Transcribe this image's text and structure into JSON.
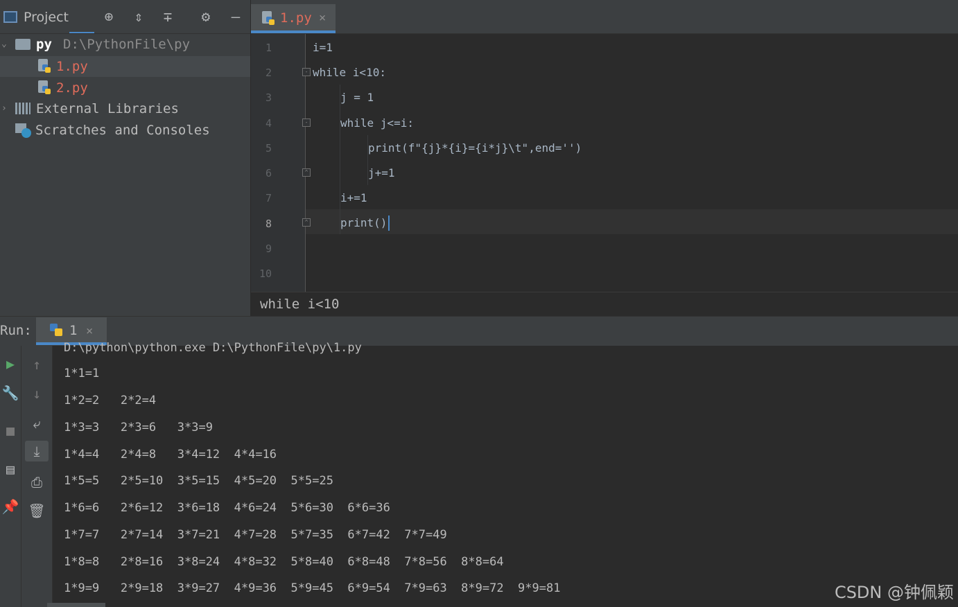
{
  "project": {
    "title": "Project",
    "tree": [
      {
        "name": "py",
        "path": "D:\\PythonFile\\py"
      },
      {
        "name": "1.py"
      },
      {
        "name": "2.py"
      },
      {
        "name": "External Libraries"
      },
      {
        "name": "Scratches and Consoles"
      }
    ]
  },
  "editor": {
    "tab_label": "1.py",
    "line_numbers": [
      "1",
      "2",
      "3",
      "4",
      "5",
      "6",
      "7",
      "8",
      "9",
      "10"
    ],
    "code": [
      "i=1",
      "while i<10:",
      "j = 1",
      "while j<=i:",
      "print(f\"{j}*{i}={i*j}\\t\",end='')",
      "j+=1",
      "i+=1",
      "print()"
    ],
    "breadcrumb": "while i<10"
  },
  "run": {
    "label": "Run:",
    "tab_label": "1",
    "command": "D:\\python\\python.exe D:\\PythonFile\\py\\1.py",
    "output_lines": [
      "1*1=1",
      "1*2=2   2*2=4",
      "1*3=3   2*3=6   3*3=9",
      "1*4=4   2*4=8   3*4=12  4*4=16",
      "1*5=5   2*5=10  3*5=15  4*5=20  5*5=25",
      "1*6=6   2*6=12  3*6=18  4*6=24  5*6=30  6*6=36",
      "1*7=7   2*7=14  3*7=21  4*7=28  5*7=35  6*7=42  7*7=49",
      "1*8=8   2*8=16  3*8=24  4*8=32  5*8=40  6*8=48  7*8=56  8*8=64",
      "1*9=9   2*9=18  3*9=27  4*9=36  5*9=45  6*9=54  7*9=63  8*9=72  9*9=81"
    ]
  },
  "watermark": "CSDN @钟佩颖",
  "colors": {
    "background": "#2b2b2b",
    "panel": "#3c3f41",
    "accent": "#4a88c7",
    "python_file_name": "#e06c5b",
    "keyword": "#c77dbb",
    "number": "#cc7832",
    "function": "#2aacb8"
  },
  "icons": [
    "project-window-icon",
    "locate-icon",
    "expand-all-icon",
    "collapse-all-icon",
    "gear-icon",
    "minimize-icon",
    "folder-icon",
    "python-file-icon",
    "libraries-icon",
    "scratches-icon",
    "close-icon",
    "run-icon",
    "wrench-icon",
    "stop-icon",
    "layout-icon",
    "pin-icon",
    "arrow-up-icon",
    "arrow-down-icon",
    "soft-wrap-icon",
    "scroll-to-end-icon",
    "print-icon",
    "trash-icon"
  ]
}
